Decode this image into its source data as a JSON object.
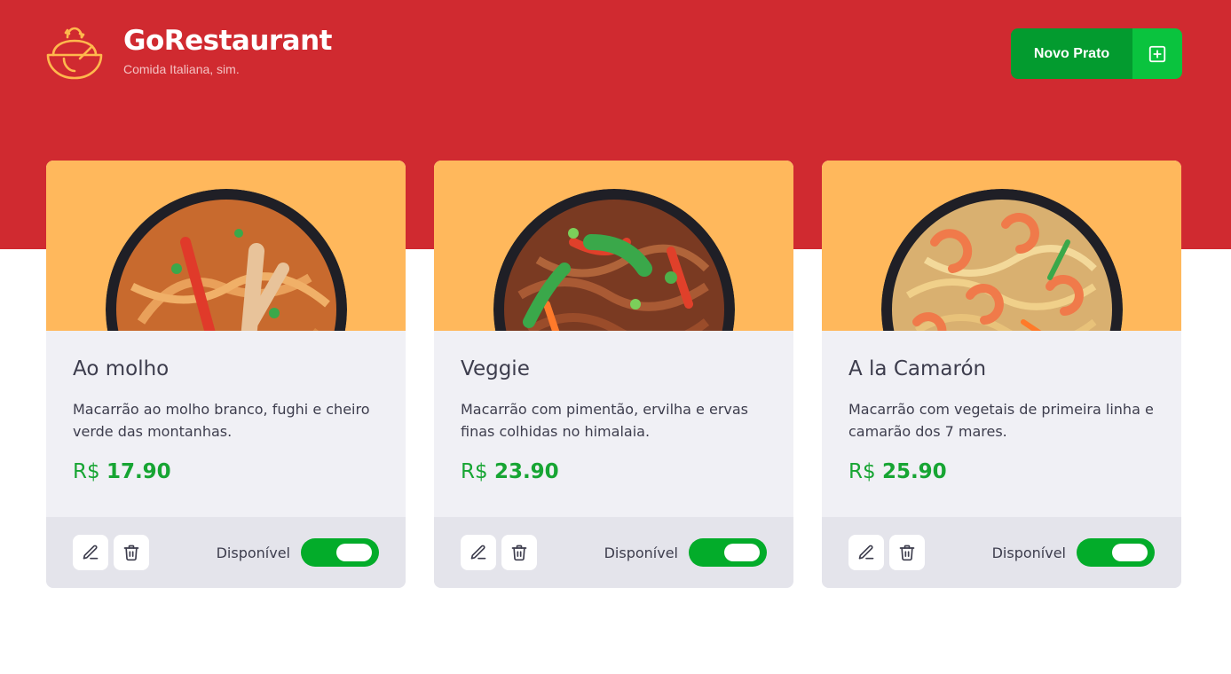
{
  "brand": {
    "title": "GoRestaurant",
    "subtitle": "Comida Italiana, sim.",
    "logo_icon": "bowl-logo-icon",
    "logo_color": "#ffb84d"
  },
  "header": {
    "new_dish_label": "Novo Prato",
    "new_dish_icon": "plus-square-icon",
    "bg_color": "#d02a30"
  },
  "dishes": [
    {
      "name": "Ao molho",
      "description": "Macarrão ao molho branco, fughi e cheiro verde das montanhas.",
      "currency": "R$",
      "price": "17.90",
      "available_label": "Disponível",
      "available": true
    },
    {
      "name": "Veggie",
      "description": "Macarrão com pimentão, ervilha e ervas finas colhidas no himalaia.",
      "currency": "R$",
      "price": "23.90",
      "available_label": "Disponível",
      "available": true
    },
    {
      "name": "A la Camarón",
      "description": "Macarrão com vegetais de primeira linha e camarão dos 7 mares.",
      "currency": "R$",
      "price": "25.90",
      "available_label": "Disponível",
      "available": true
    }
  ],
  "colors": {
    "accent_green": "#039b2f",
    "price_green": "#17a533",
    "card_media": "#ffb85c"
  }
}
